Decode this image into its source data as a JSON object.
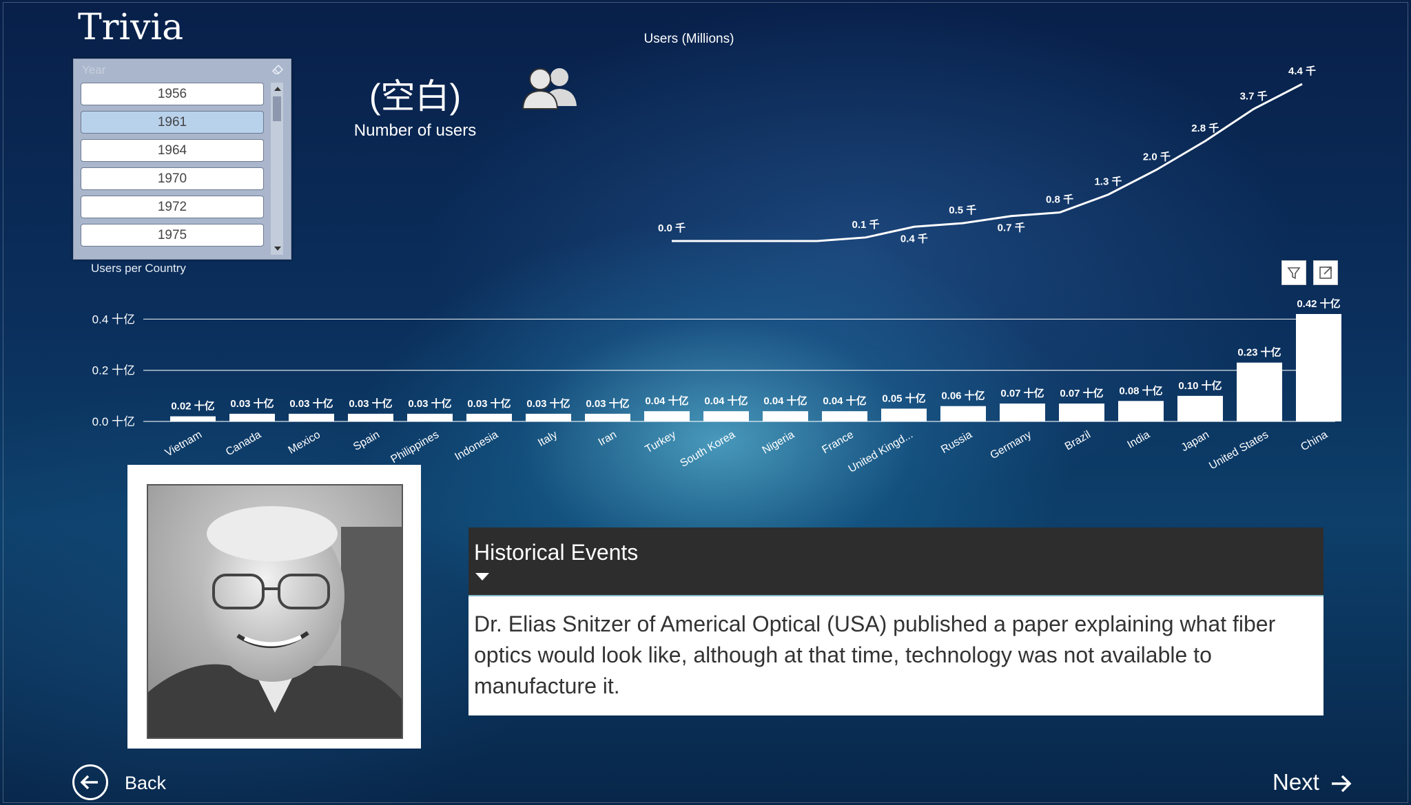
{
  "page": {
    "title": "Trivia"
  },
  "slicer": {
    "header": "Year",
    "items": [
      "1956",
      "1961",
      "1964",
      "1970",
      "1972",
      "1975"
    ],
    "selected_index": 1
  },
  "card": {
    "value": "(空白)",
    "label": "Number of users"
  },
  "line_chart_title": "Users (Millions)",
  "bar_chart_title": "Users per Country",
  "chart_data": [
    {
      "type": "line",
      "title": "Users (Millions)",
      "points": [
        {
          "v": 0.0,
          "label": "0.0 千"
        },
        {
          "v": 0.0,
          "label": ""
        },
        {
          "v": 0.0,
          "label": ""
        },
        {
          "v": 0.0,
          "label": ""
        },
        {
          "v": 0.1,
          "label": "0.1 千"
        },
        {
          "v": 0.4,
          "label": "0.4 千",
          "below": true
        },
        {
          "v": 0.5,
          "label": "0.5 千"
        },
        {
          "v": 0.7,
          "label": "0.7 千",
          "below": true
        },
        {
          "v": 0.8,
          "label": "0.8 千"
        },
        {
          "v": 1.3,
          "label": "1.3 千"
        },
        {
          "v": 2.0,
          "label": "2.0 千"
        },
        {
          "v": 2.8,
          "label": "2.8 千"
        },
        {
          "v": 3.7,
          "label": "3.7 千"
        },
        {
          "v": 4.4,
          "label": "4.4 千"
        }
      ],
      "color": "#ffffff"
    },
    {
      "type": "bar",
      "title": "Users per Country",
      "categories": [
        "Vietnam",
        "Canada",
        "Mexico",
        "Spain",
        "Philippines",
        "Indonesia",
        "Italy",
        "Iran",
        "Turkey",
        "South Korea",
        "Nigeria",
        "France",
        "United Kingd...",
        "Russia",
        "Germany",
        "Brazil",
        "India",
        "Japan",
        "United States",
        "China"
      ],
      "values": [
        0.02,
        0.03,
        0.03,
        0.03,
        0.03,
        0.03,
        0.03,
        0.03,
        0.04,
        0.04,
        0.04,
        0.04,
        0.05,
        0.06,
        0.07,
        0.07,
        0.08,
        0.1,
        0.23,
        0.42
      ],
      "data_labels": [
        "0.02 十亿",
        "0.03 十亿",
        "0.03 十亿",
        "0.03 十亿",
        "0.03 十亿",
        "0.03 十亿",
        "0.03 十亿",
        "0.03 十亿",
        "0.04 十亿",
        "0.04 十亿",
        "0.04 十亿",
        "0.04 十亿",
        "0.05 十亿",
        "0.06 十亿",
        "0.07 十亿",
        "0.07 十亿",
        "0.08 十亿",
        "0.10 十亿",
        "0.23 十亿",
        "0.42 十亿"
      ],
      "y_ticks": [
        "0.0 十亿",
        "0.2 十亿",
        "0.4 十亿"
      ],
      "y_tick_values": [
        0,
        0.2,
        0.4
      ],
      "ylim": [
        0,
        0.42
      ],
      "grid": true,
      "color": "#ffffff"
    }
  ],
  "events": {
    "title": "Historical Events",
    "body": "Dr. Elias Snitzer of Americal Optical (USA) published a paper explaining what fiber optics would look like, although at that time, technology was not available to manufacture it."
  },
  "nav": {
    "back_label": "Back",
    "next_label": "Next"
  },
  "icons": {
    "users": "users-icon",
    "eraser": "eraser-icon",
    "filter": "filter-icon",
    "focus": "focus-mode-icon",
    "back": "arrow-left-circle-icon",
    "next": "arrow-right-icon",
    "caret": "caret-down-icon"
  }
}
